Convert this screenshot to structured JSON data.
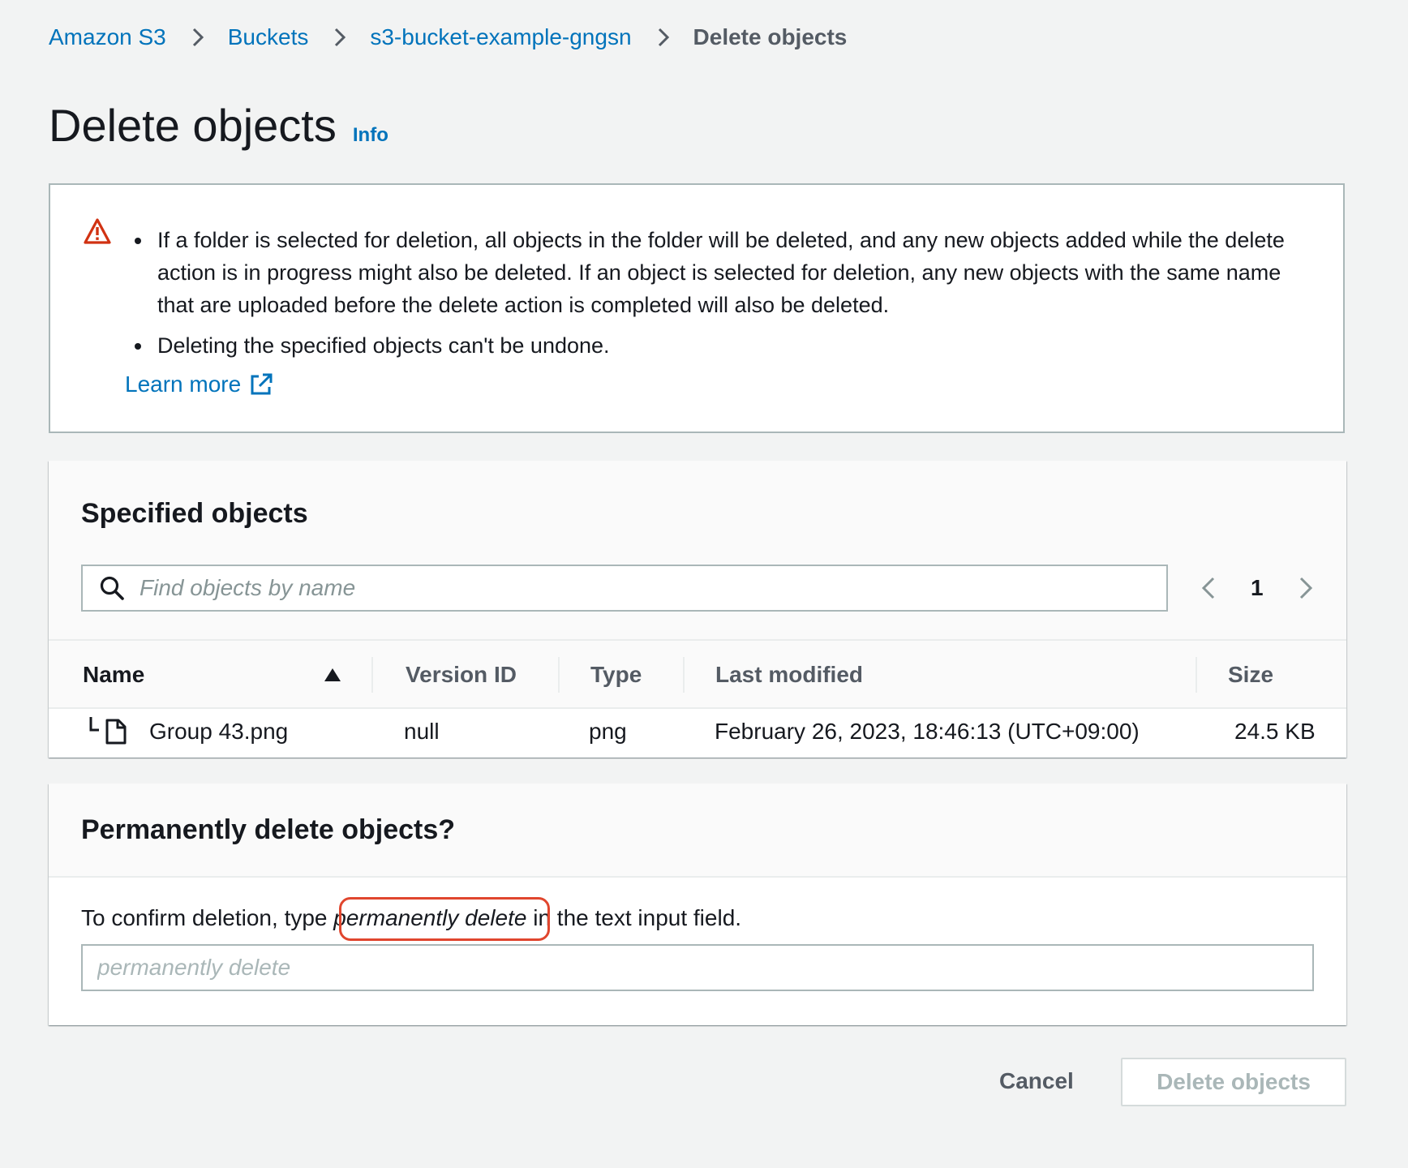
{
  "breadcrumb": {
    "items": [
      {
        "label": "Amazon S3"
      },
      {
        "label": "Buckets"
      },
      {
        "label": "s3-bucket-example-gngsn"
      }
    ],
    "current": "Delete objects"
  },
  "page": {
    "title": "Delete objects",
    "info_link": "Info"
  },
  "alert": {
    "icon": "warning-icon",
    "color": "#d13212",
    "bullets": [
      "If a folder is selected for deletion, all objects in the folder will be deleted, and any new objects added while the delete action is in progress might also be deleted. If an object is selected for deletion, any new objects with the same name that are uploaded before the delete action is completed will also be deleted.",
      "Deleting the specified objects can't be undone."
    ],
    "learn_more": "Learn more"
  },
  "specified_objects": {
    "title": "Specified objects",
    "search_placeholder": "Find objects by name",
    "pagination": {
      "current_page": "1"
    },
    "columns": [
      "Name",
      "Version ID",
      "Type",
      "Last modified",
      "Size"
    ],
    "sort": {
      "column": "Name",
      "direction": "ascending"
    },
    "rows": [
      {
        "name": "Group 43.png",
        "version_id": "null",
        "type": "png",
        "last_modified": "February 26, 2023, 18:46:13 (UTC+09:00)",
        "size": "24.5 KB"
      }
    ]
  },
  "confirm": {
    "title": "Permanently delete objects?",
    "text_before": "To confirm deletion, type ",
    "keyword": "permanently delete",
    "text_after": " in the text input field.",
    "input_placeholder": "permanently delete",
    "input_value": ""
  },
  "actions": {
    "cancel": "Cancel",
    "delete": "Delete objects"
  },
  "colors": {
    "link": "#0073bb",
    "highlight_ring": "#e0462e",
    "disabled_button_text": "#aab7b8"
  }
}
